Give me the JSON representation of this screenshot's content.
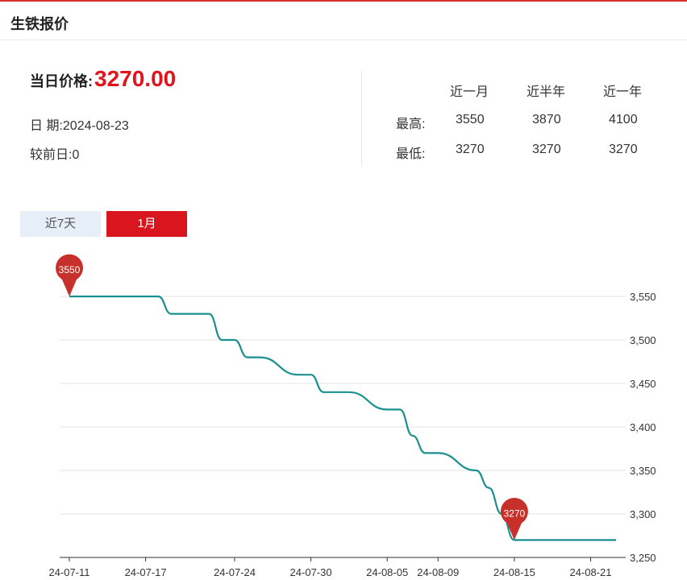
{
  "header": {
    "title": "生铁报价"
  },
  "summary": {
    "price_label": "当日价格:",
    "price_value": "3270.00",
    "date_label": "日 期:",
    "date_value": "2024-08-23",
    "change_label": "较前日:",
    "change_value": "0"
  },
  "stats": {
    "columns": [
      "近一月",
      "近半年",
      "近一年"
    ],
    "rows": [
      {
        "label": "最高:",
        "values": [
          "3550",
          "3870",
          "4100"
        ]
      },
      {
        "label": "最低:",
        "values": [
          "3270",
          "3270",
          "3270"
        ]
      }
    ]
  },
  "tabs": [
    {
      "label": "近7天",
      "active": false
    },
    {
      "label": "1月",
      "active": true
    }
  ],
  "colors": {
    "accent": "#d9161e",
    "line": "#1a8f8f",
    "pin": "#c8312b"
  },
  "chart_data": {
    "type": "line",
    "x_ticks": [
      "24-07-11",
      "24-07-17",
      "24-07-24",
      "24-07-30",
      "24-08-05",
      "24-08-09",
      "24-08-15",
      "24-08-21"
    ],
    "x": [
      "2024-07-11",
      "2024-07-12",
      "2024-07-15",
      "2024-07-16",
      "2024-07-17",
      "2024-07-18",
      "2024-07-19",
      "2024-07-22",
      "2024-07-23",
      "2024-07-24",
      "2024-07-25",
      "2024-07-26",
      "2024-07-29",
      "2024-07-30",
      "2024-07-31",
      "2024-08-01",
      "2024-08-02",
      "2024-08-05",
      "2024-08-06",
      "2024-08-07",
      "2024-08-08",
      "2024-08-09",
      "2024-08-12",
      "2024-08-13",
      "2024-08-14",
      "2024-08-15",
      "2024-08-16",
      "2024-08-19",
      "2024-08-20",
      "2024-08-21",
      "2024-08-22",
      "2024-08-23"
    ],
    "series": [
      {
        "values": [
          3550,
          3550,
          3550,
          3550,
          3550,
          3550,
          3530,
          3530,
          3500,
          3500,
          3480,
          3480,
          3460,
          3460,
          3440,
          3440,
          3440,
          3420,
          3420,
          3390,
          3370,
          3370,
          3350,
          3330,
          3300,
          3270,
          3270,
          3270,
          3270,
          3270,
          3270,
          3270
        ]
      }
    ],
    "ylim": [
      3250,
      3550
    ],
    "y_ticks": [
      "3,250",
      "3,300",
      "3,350",
      "3,400",
      "3,450",
      "3,500",
      "3,550"
    ],
    "markers": [
      {
        "label": "3550",
        "index": 0
      },
      {
        "label": "3270",
        "index": 25
      }
    ],
    "grid": true,
    "xlabel": "",
    "ylabel": ""
  }
}
